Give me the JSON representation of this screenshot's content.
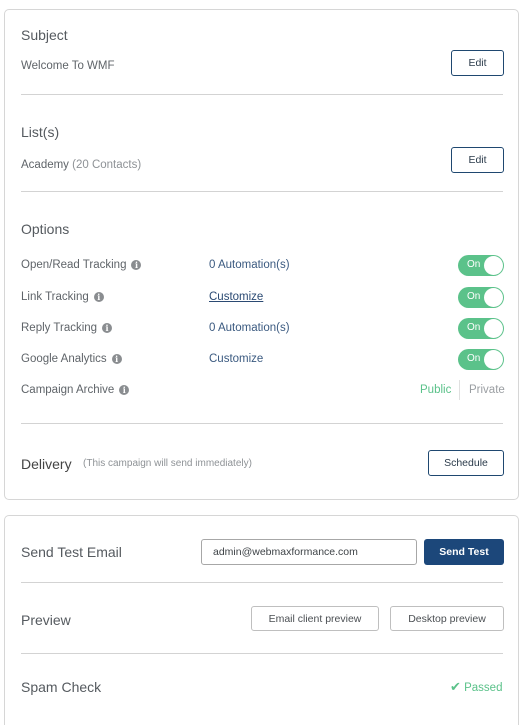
{
  "subject": {
    "heading": "Subject",
    "value": "Welcome To WMF",
    "edit_label": "Edit"
  },
  "lists": {
    "heading": "List(s)",
    "name": "Academy",
    "count": "(20 Contacts)",
    "edit_label": "Edit"
  },
  "options": {
    "heading": "Options",
    "rows": [
      {
        "label": "Open/Read Tracking",
        "link": "0 Automation(s)",
        "toggle": "On"
      },
      {
        "label": "Link Tracking",
        "link": "Customize",
        "toggle": "On"
      },
      {
        "label": "Reply Tracking",
        "link": "0 Automation(s)",
        "toggle": "On"
      },
      {
        "label": "Google Analytics",
        "link": "Customize",
        "toggle": "On"
      }
    ],
    "archive": {
      "label": "Campaign Archive",
      "public_label": "Public",
      "private_label": "Private",
      "selected": "Public"
    },
    "info_glyph": "i"
  },
  "delivery": {
    "heading": "Delivery",
    "note": "(This campaign will send immediately)",
    "schedule_label": "Schedule"
  },
  "send_test": {
    "heading": "Send Test Email",
    "email_value": "admin@webmaxformance.com",
    "button_label": "Send Test"
  },
  "preview": {
    "heading": "Preview",
    "email_client_label": "Email client preview",
    "desktop_label": "Desktop preview"
  },
  "spam_check": {
    "heading": "Spam Check",
    "status_icon": "✔",
    "status": "Passed"
  },
  "colors": {
    "accent_green": "#5bc28a",
    "primary_blue": "#1c477a",
    "link_blue": "#3b5a80"
  }
}
